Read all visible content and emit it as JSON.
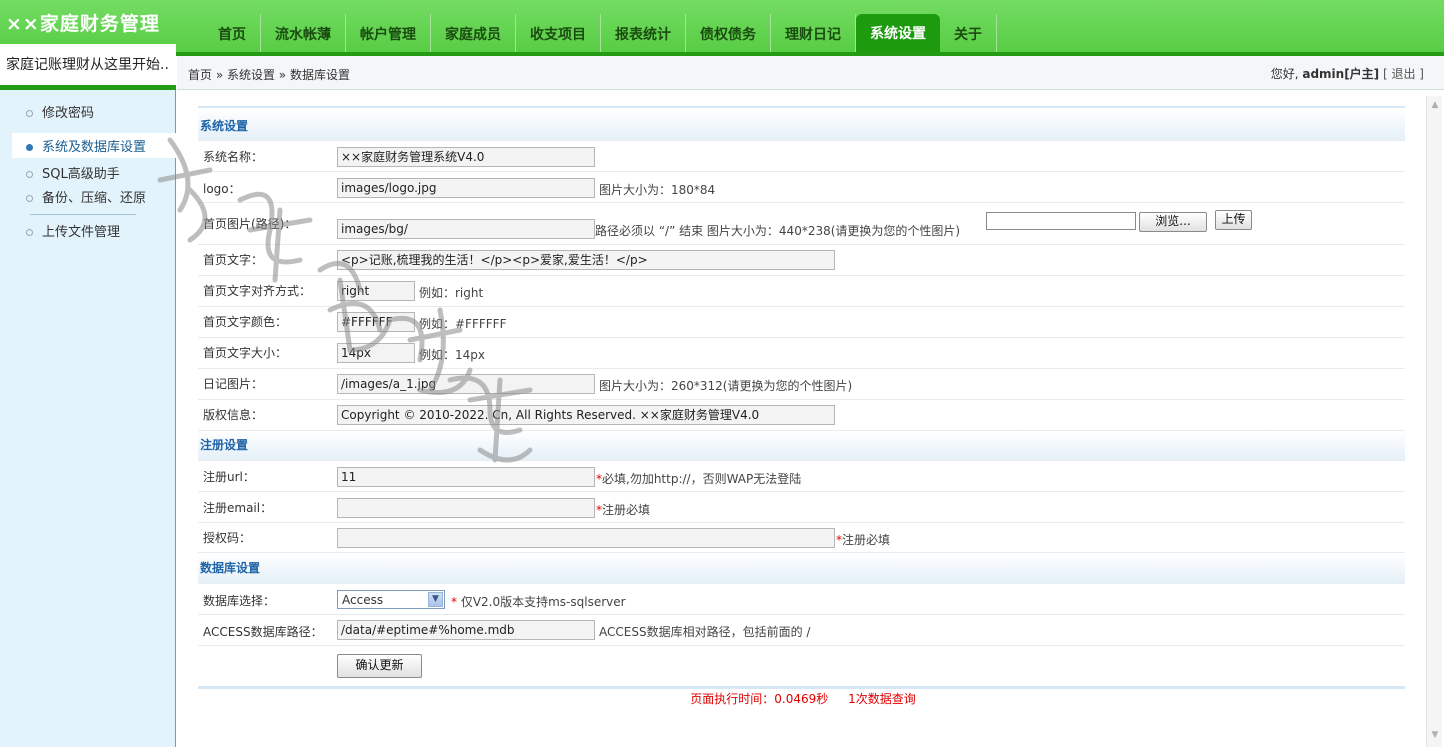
{
  "app": {
    "title": "××家庭财务管理",
    "slogan": "家庭记账理财从这里开始.."
  },
  "nav": [
    {
      "label": "首页"
    },
    {
      "label": "流水帐薄"
    },
    {
      "label": "帐户管理"
    },
    {
      "label": "家庭成员"
    },
    {
      "label": "收支项目"
    },
    {
      "label": "报表统计"
    },
    {
      "label": "债权债务"
    },
    {
      "label": "理财日记"
    },
    {
      "label": "系统设置",
      "active": true
    },
    {
      "label": "关于"
    }
  ],
  "sidebar": {
    "items": [
      {
        "label": "修改密码"
      },
      {
        "label": "系统及数据库设置",
        "active": true
      },
      {
        "label": "SQL高级助手"
      },
      {
        "label": "备份、压缩、还原"
      },
      {
        "label": "上传文件管理"
      }
    ]
  },
  "breadcrumb": "首页 » 系统设置 » 数据库设置",
  "user": {
    "greeting": "您好,",
    "name": "admin[户主]",
    "logout": "[ 退出 ]"
  },
  "sections": {
    "system": "系统设置",
    "register": "注册设置",
    "database": "数据库设置"
  },
  "fields": {
    "system_name": {
      "label": "系统名称：",
      "value": "××家庭财务管理系统V4.0"
    },
    "logo": {
      "label": "logo：",
      "value": "images/logo.jpg",
      "hint": "图片大小为：180*84"
    },
    "home_image": {
      "label": "首页图片(路径)：",
      "value": "images/bg/",
      "hint": "路径必须以 “/” 结束 图片大小为：440*238(请更换为您的个性图片)",
      "browse_label": "浏览...",
      "upload_label": "上传"
    },
    "home_text": {
      "label": "首页文字：",
      "value": "<p>记账,梳理我的生活！</p><p>爱家,爱生活！</p>"
    },
    "home_text_align": {
      "label": "首页文字对齐方式：",
      "value": "right",
      "hint": "例如：right"
    },
    "home_text_color": {
      "label": "首页文字颜色：",
      "value": "#FFFFFF",
      "hint": "例如：#FFFFFF"
    },
    "home_text_size": {
      "label": "首页文字大小：",
      "value": "14px",
      "hint": "例如：14px"
    },
    "diary_image": {
      "label": "日记图片：",
      "value": "/images/a_1.jpg",
      "hint": "图片大小为：260*312(请更换为您的个性图片)"
    },
    "copyright": {
      "label": "版权信息：",
      "value": "Copyright © 2010-2022. Cn, All Rights Reserved.  ××家庭财务管理V4.0"
    },
    "register_url": {
      "label": "注册url：",
      "value": "11",
      "hint": "必填,勿加http://，否则WAP无法登陆"
    },
    "register_email": {
      "label": "注册email：",
      "value": "",
      "hint": "注册必填"
    },
    "auth_code": {
      "label": "授权码：",
      "value": "",
      "hint": "注册必填"
    },
    "db_select": {
      "label": "数据库选择：",
      "value": "Access",
      "hint": " 仅V2.0版本支持ms-sqlserver"
    },
    "access_path": {
      "label": "ACCESS数据库路径：",
      "value": "/data/#eptime#%home.mdb",
      "hint": "ACCESS数据库相对路径，包括前面的 /"
    }
  },
  "submit_label": "确认更新",
  "footer": {
    "exec_time": "页面执行时间：0.0469秒",
    "queries": "1次数据查询"
  },
  "colors": {
    "header_green": "#55cc42",
    "nav_active": "#1d9a0e",
    "sidebar_bg": "#e3f3fc",
    "section_text": "#1f64a8",
    "required": "#e00000"
  }
}
